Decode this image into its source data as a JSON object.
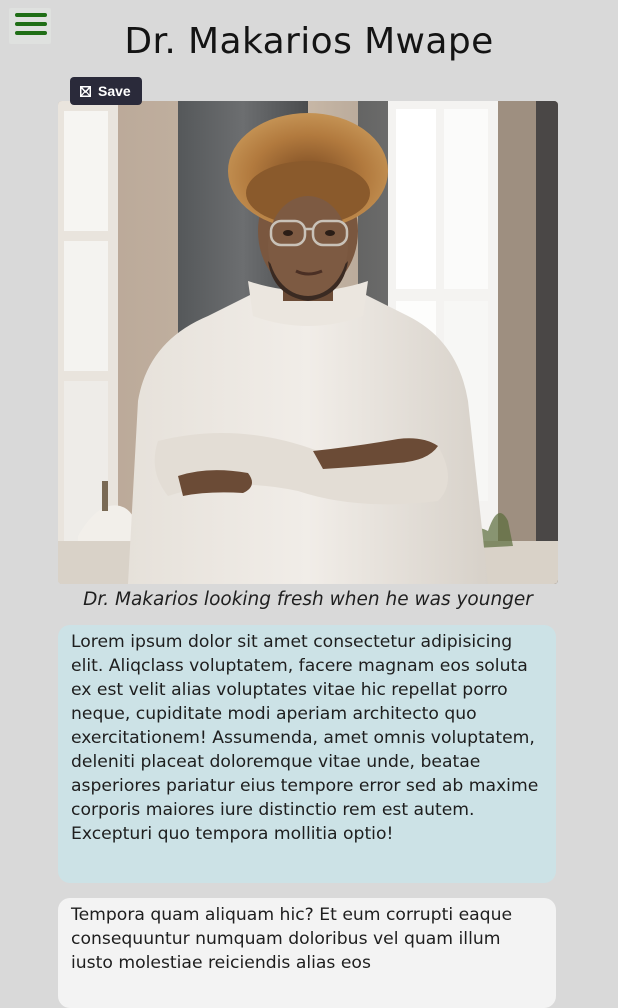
{
  "header": {
    "title": "Dr. Makarios Mwape",
    "menu_icon": "hamburger-menu-icon",
    "menu_color": "#1f6e16"
  },
  "photo": {
    "save_label": "Save",
    "save_icon": "bookmark-save-icon",
    "caption": "Dr. Makarios looking fresh when he was younger"
  },
  "paragraphs": [
    "Lorem ipsum dolor sit amet consectetur adipisicing elit. Aliqclass voluptatem, facere magnam eos soluta ex est velit alias voluptates vitae hic repellat porro neque, cupiditate modi aperiam architecto quo exercitationem! Assumenda, amet omnis voluptatem, deleniti placeat doloremque vitae unde, beatae asperiores pariatur eius tempore error sed ab maxime corporis maiores iure distinctio rem est autem. Excepturi quo tempora mollitia optio!",
    "Tempora quam aliquam hic? Et eum corrupti eaque consequuntur numquam doloribus vel quam illum iusto molestiae reiciendis alias eos"
  ],
  "colors": {
    "background": "#d9d9d9",
    "card_primary": "#cce2e6",
    "card_secondary": "#f3f3f3",
    "save_button": "#2a2a3a"
  }
}
